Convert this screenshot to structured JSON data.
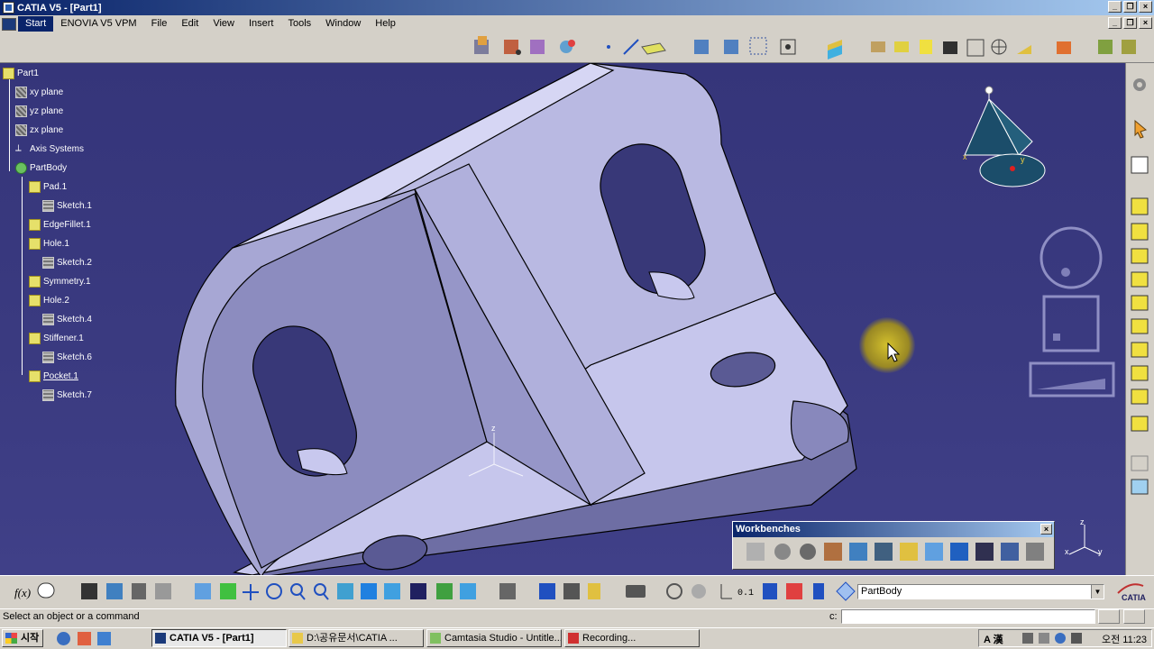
{
  "window": {
    "title": "CATIA V5 - [Part1]",
    "controls": [
      "_",
      "▫",
      "×"
    ]
  },
  "menu": [
    "Start",
    "ENOVIA V5 VPM",
    "File",
    "Edit",
    "View",
    "Insert",
    "Tools",
    "Window",
    "Help"
  ],
  "tree": {
    "nodes": [
      {
        "label": "Part1",
        "icon": "part-icon",
        "depth": 0
      },
      {
        "label": "xy plane",
        "icon": "plane-icon",
        "depth": 1
      },
      {
        "label": "yz plane",
        "icon": "plane-icon",
        "depth": 1
      },
      {
        "label": "zx plane",
        "icon": "plane-icon",
        "depth": 1
      },
      {
        "label": "Axis Systems",
        "icon": "axis-icon",
        "depth": 1
      },
      {
        "label": "PartBody",
        "icon": "body-icon",
        "depth": 1
      },
      {
        "label": "Pad.1",
        "icon": "pad-icon",
        "depth": 2
      },
      {
        "label": "Sketch.1",
        "icon": "sketch-icon",
        "depth": 3
      },
      {
        "label": "EdgeFillet.1",
        "icon": "fillet-icon",
        "depth": 2
      },
      {
        "label": "Hole.1",
        "icon": "hole-icon",
        "depth": 2
      },
      {
        "label": "Sketch.2",
        "icon": "sketch-icon",
        "depth": 3
      },
      {
        "label": "Symmetry.1",
        "icon": "symmetry-icon",
        "depth": 2
      },
      {
        "label": "Hole.2",
        "icon": "hole-icon",
        "depth": 2
      },
      {
        "label": "Sketch.4",
        "icon": "sketch-icon",
        "depth": 3
      },
      {
        "label": "Stiffener.1",
        "icon": "stiffener-icon",
        "depth": 2
      },
      {
        "label": "Sketch.6",
        "icon": "sketch-icon",
        "depth": 3
      },
      {
        "label": "Pocket.1",
        "icon": "pocket-icon",
        "depth": 2
      },
      {
        "label": "Sketch.7",
        "icon": "sketch-icon",
        "depth": 3
      }
    ]
  },
  "workbenches": {
    "title": "Workbenches",
    "close": "×"
  },
  "compass": {
    "axis_x": "x",
    "axis_y": "y",
    "axis_z": "z"
  },
  "triad": {
    "x": "x",
    "y": "y",
    "z": "z"
  },
  "bottom": {
    "current_body": "PartBody",
    "logo": "CATIA"
  },
  "status": {
    "message": "Select an object or a command",
    "cmd_label": "c:"
  },
  "taskbar": {
    "start": "시작",
    "tasks": [
      "CATIA V5 - [Part1]",
      "D:\\공유문서\\CATIA ...",
      "Camtasia Studio - Untitle...",
      "Recording..."
    ],
    "tray_text": "A 漢",
    "clock": "오전 11:23"
  },
  "colors": {
    "viewport_bg": "#3a3a80",
    "part_face": "#c8c8ec",
    "part_shadow": "#8a8ab8",
    "title_gradient_start": "#0a246a",
    "title_gradient_end": "#a6caf0"
  }
}
